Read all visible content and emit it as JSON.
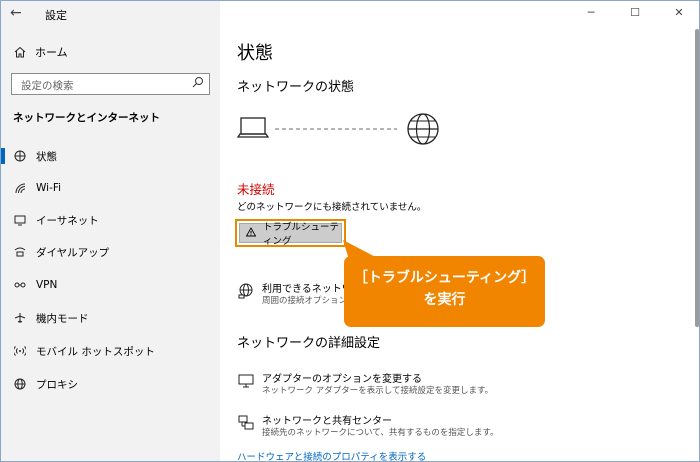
{
  "window": {
    "title": "設定",
    "controls": {
      "minimize": "─",
      "maximize": "☐",
      "close": "✕"
    }
  },
  "sidebar": {
    "home_label": "ホーム",
    "search_placeholder": "設定の検索",
    "section_header": "ネットワークとインターネット",
    "items": [
      {
        "label": "状態",
        "icon": "status-globe-icon",
        "active": true
      },
      {
        "label": "Wi-Fi",
        "icon": "wifi-icon"
      },
      {
        "label": "イーサネット",
        "icon": "ethernet-icon"
      },
      {
        "label": "ダイヤルアップ",
        "icon": "dialup-icon"
      },
      {
        "label": "VPN",
        "icon": "vpn-icon"
      },
      {
        "label": "機内モード",
        "icon": "airplane-icon"
      },
      {
        "label": "モバイル ホットスポット",
        "icon": "hotspot-icon"
      },
      {
        "label": "プロキシ",
        "icon": "proxy-globe-icon"
      }
    ]
  },
  "main": {
    "page_title": "状態",
    "network_status_heading": "ネットワークの状態",
    "status_title": "未接続",
    "status_desc": "どのネットワークにも接続されていません。",
    "troubleshoot_label": "トラブルシューティング",
    "available_networks": {
      "title": "利用できるネットワーク",
      "sub": "周囲の接続オプションを"
    },
    "advanced_heading": "ネットワークの詳細設定",
    "adapter_options": {
      "title": "アダプターのオプションを変更する",
      "sub": "ネットワーク アダプターを表示して接続設定を変更します。"
    },
    "sharing_center": {
      "title": "ネットワークと共有センター",
      "sub": "接続先のネットワークについて、共有するものを指定します。"
    },
    "hardware_link": "ハードウェアと接続のプロパティを表示する"
  },
  "callout": {
    "line1": "［トラブルシューティング］",
    "line2": "を実行",
    "color": "#f28500"
  },
  "colors": {
    "accent": "#0067c0",
    "error": "#d40000",
    "highlight_border": "#e58a00"
  }
}
